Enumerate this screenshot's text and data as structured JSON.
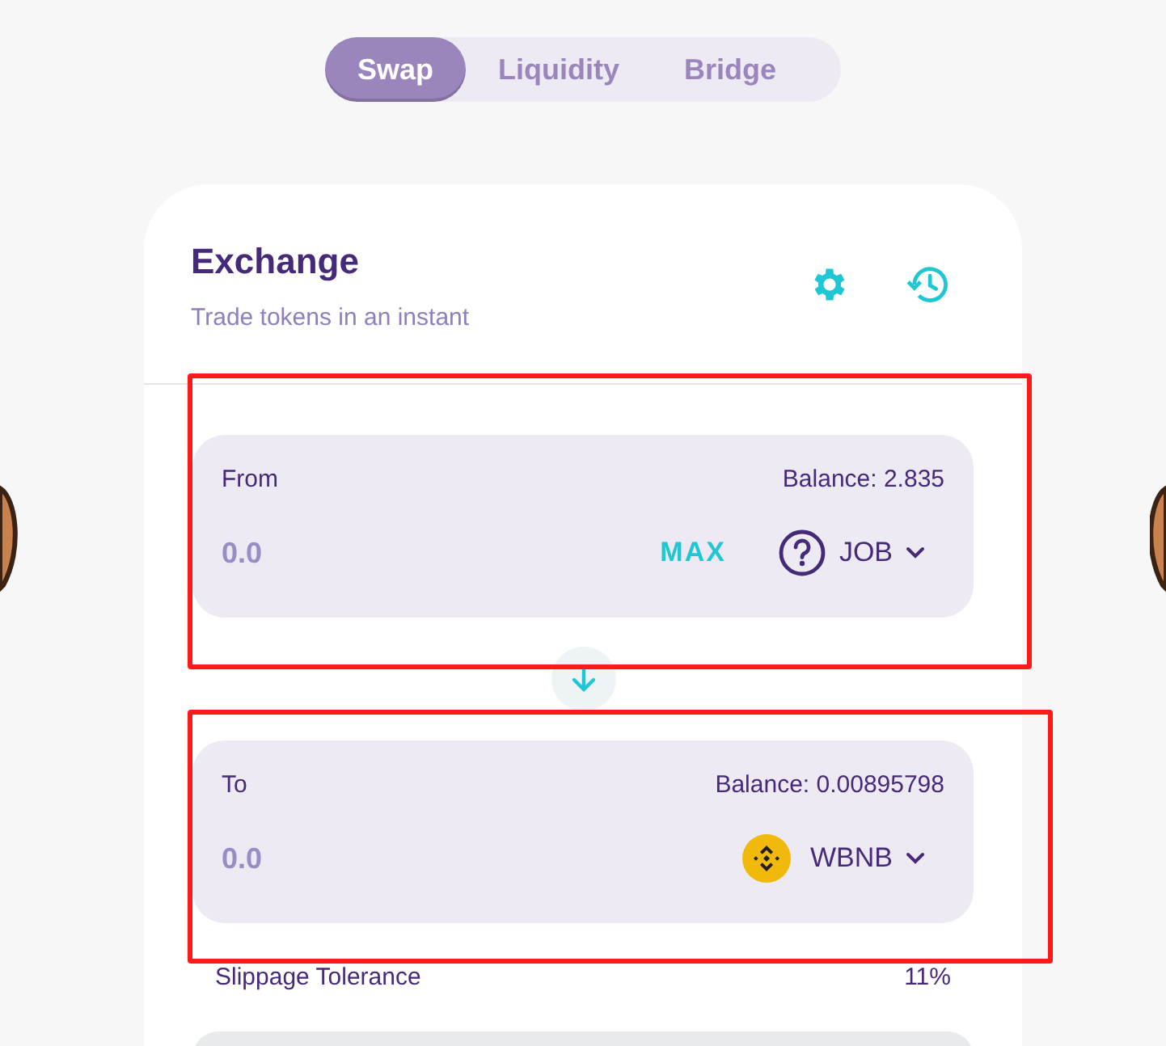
{
  "tabs": [
    {
      "label": "Swap",
      "selected": true
    },
    {
      "label": "Liquidity",
      "selected": false
    },
    {
      "label": "Bridge",
      "selected": false
    }
  ],
  "card": {
    "title": "Exchange",
    "subtitle": "Trade tokens in an instant"
  },
  "panels": [
    {
      "label": "From",
      "balance": "Balance: 2.835",
      "placeholder": "0.0",
      "max": "MAX",
      "token": "JOB",
      "kind": "unknown",
      "highlighted": true
    },
    {
      "label": "To",
      "balance": "Balance: 0.00895798",
      "placeholder": "0.0",
      "token": "WBNB",
      "kind": "bnb",
      "highlighted": true
    }
  ],
  "slippage": {
    "label": "Slippage Tolerance",
    "value": "11%"
  }
}
